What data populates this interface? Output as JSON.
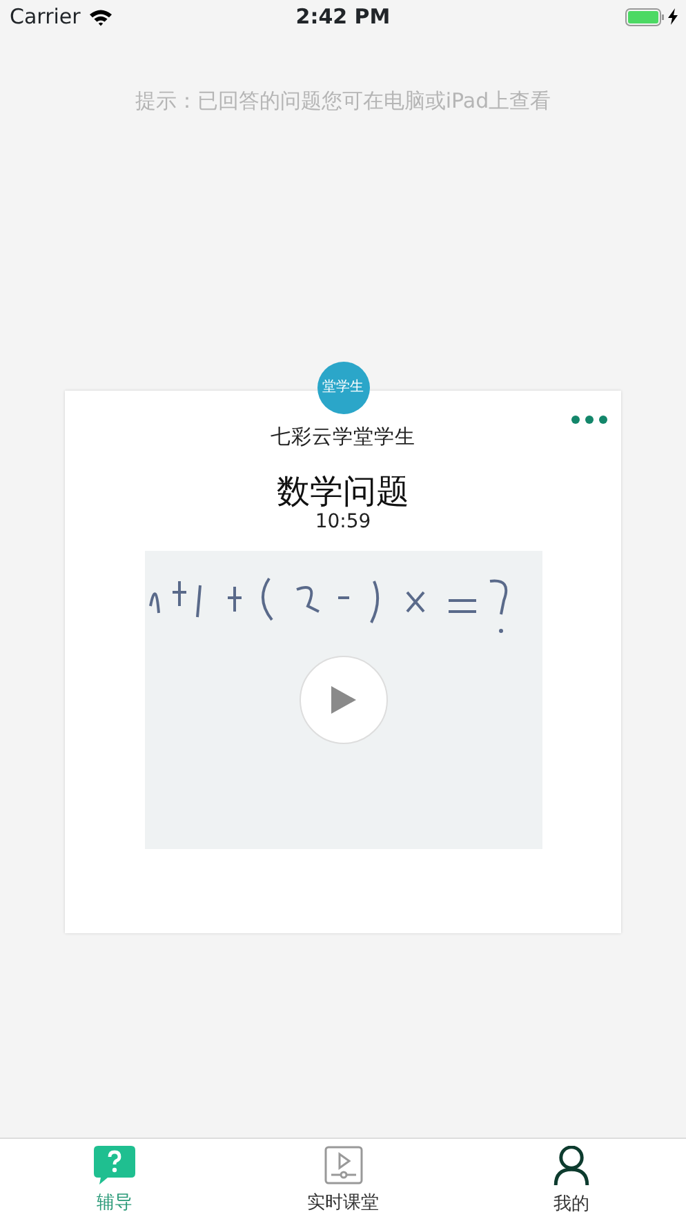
{
  "status_bar": {
    "carrier": "Carrier",
    "time": "2:42 PM",
    "charging": true
  },
  "hint": "提示：已回答的问题您可在电脑或iPad上查看",
  "card": {
    "avatar_text": "堂学生",
    "author": "七彩云学堂学生",
    "title": "数学问题",
    "time": "10:59"
  },
  "tab_bar": [
    {
      "label": "辅导",
      "kind": "question",
      "selected": true
    },
    {
      "label": "实时课堂",
      "kind": "video",
      "selected": false
    },
    {
      "label": "我的",
      "kind": "person",
      "selected": false
    }
  ]
}
